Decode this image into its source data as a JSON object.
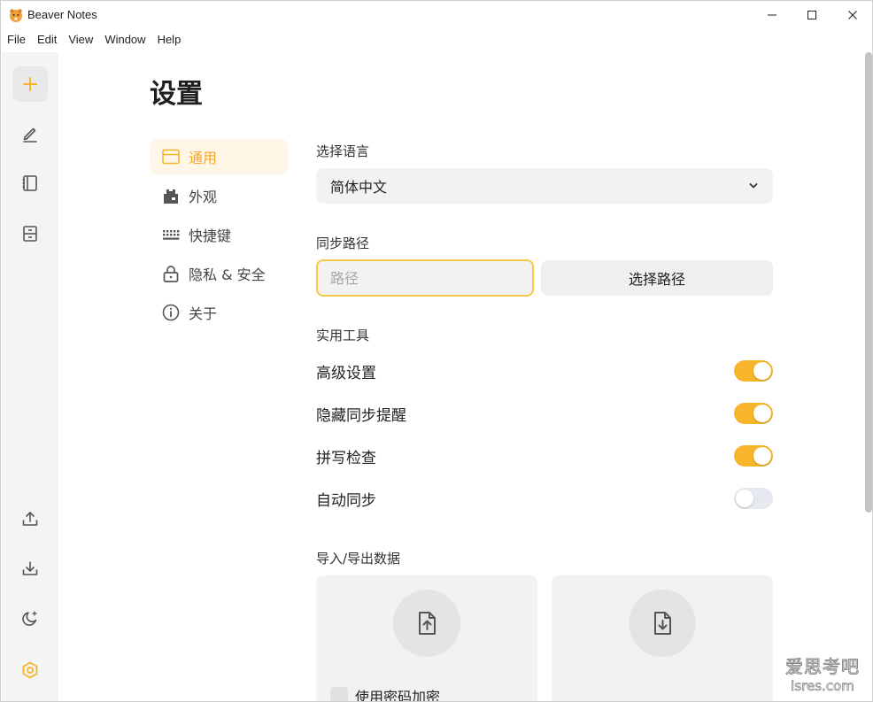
{
  "window": {
    "title": "Beaver Notes",
    "controls": [
      "minimize-icon",
      "maximize-icon",
      "close-icon"
    ]
  },
  "menu": [
    "File",
    "Edit",
    "View",
    "Window",
    "Help"
  ],
  "sidebar": {
    "top": [
      {
        "icon": "plus-icon",
        "name": "new-note"
      },
      {
        "icon": "pencil-icon",
        "name": "notes"
      },
      {
        "icon": "notebook-icon",
        "name": "folders"
      },
      {
        "icon": "archive-icon",
        "name": "archive"
      }
    ],
    "bottom": [
      {
        "icon": "upload-icon",
        "name": "export"
      },
      {
        "icon": "download-icon",
        "name": "import"
      },
      {
        "icon": "moon-icon",
        "name": "theme"
      },
      {
        "icon": "settings-hex-icon",
        "name": "settings"
      }
    ]
  },
  "settings": {
    "title": "设置",
    "nav": [
      {
        "label": "通用",
        "icon": "window-icon",
        "active": true
      },
      {
        "label": "外观",
        "icon": "appearance-icon",
        "active": false
      },
      {
        "label": "快捷键",
        "icon": "keyboard-icon",
        "active": false
      },
      {
        "label": "隐私 & 安全",
        "icon": "lock-icon",
        "active": false
      },
      {
        "label": "关于",
        "icon": "info-icon",
        "active": false
      }
    ],
    "language": {
      "label": "选择语言",
      "value": "简体中文"
    },
    "sync_path": {
      "label": "同步路径",
      "placeholder": "路径",
      "button": "选择路径"
    },
    "tools": {
      "label": "实用工具",
      "items": [
        {
          "label": "高级设置",
          "on": true
        },
        {
          "label": "隐藏同步提醒",
          "on": true
        },
        {
          "label": "拼写检查",
          "on": true
        },
        {
          "label": "自动同步",
          "on": false
        }
      ]
    },
    "import_export": {
      "label": "导入/导出数据",
      "export_icon": "file-upload-icon",
      "import_icon": "file-download-icon",
      "encrypt_label": "使用密码加密"
    }
  },
  "watermark": {
    "line1": "爱思考吧",
    "line2": "isres.com"
  },
  "colors": {
    "accent": "#f6b52a",
    "active_nav_bg": "#fef6e6"
  }
}
